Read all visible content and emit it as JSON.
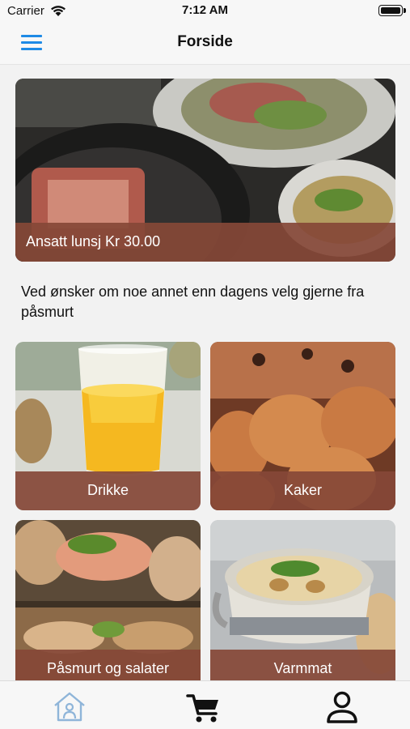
{
  "status_bar": {
    "carrier": "Carrier",
    "time": "7:12 AM"
  },
  "nav": {
    "title": "Forside",
    "menu_icon": "hamburger-menu-icon"
  },
  "hero": {
    "caption": "Ansatt lunsj Kr 30.00"
  },
  "info_text": "Ved ønsker om noe annet enn dagens velg gjerne fra påsmurt",
  "categories": [
    {
      "label": "Drikke"
    },
    {
      "label": "Kaker"
    },
    {
      "label": "Påsmurt og salater"
    },
    {
      "label": "Varmmat"
    }
  ],
  "tab_bar": {
    "items": [
      {
        "icon": "home-icon",
        "active": true
      },
      {
        "icon": "cart-icon",
        "active": false
      },
      {
        "icon": "profile-icon",
        "active": false
      }
    ]
  },
  "colors": {
    "accent": "#1e8ae6",
    "caption_band": "#854837",
    "active_tab": "#8fb5d9"
  }
}
